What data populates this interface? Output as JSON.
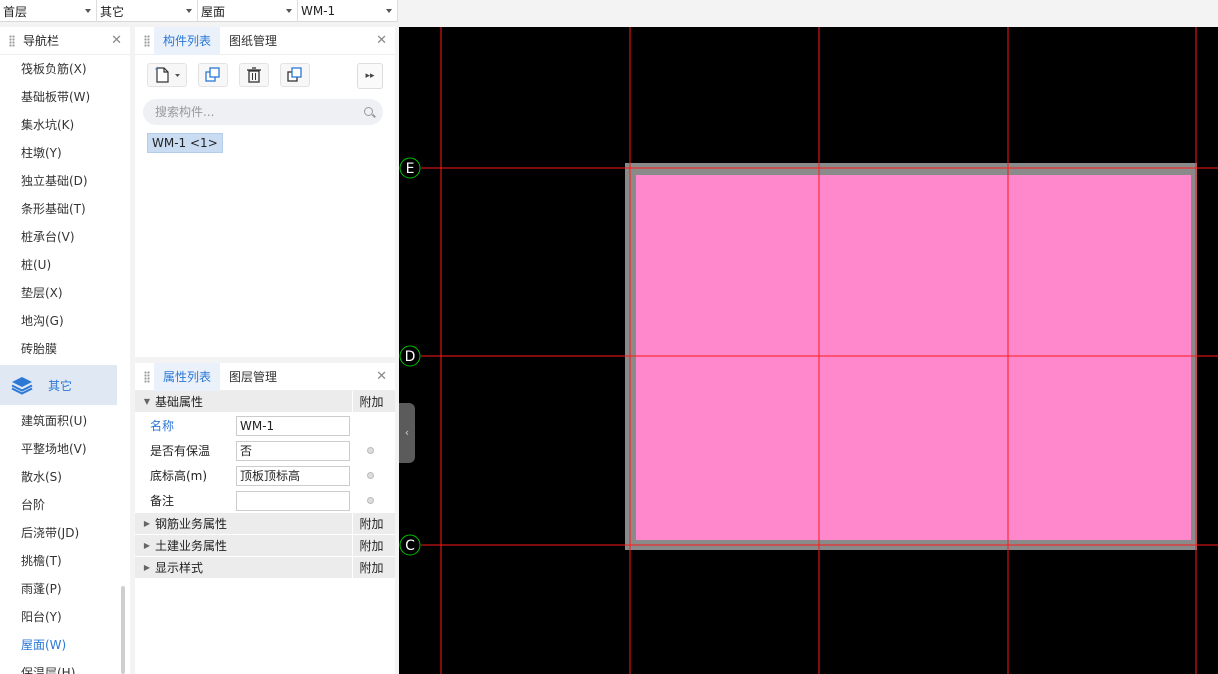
{
  "top_selectors": [
    {
      "value": "首层"
    },
    {
      "value": "其它"
    },
    {
      "value": "屋面"
    },
    {
      "value": "WM-1"
    }
  ],
  "nav": {
    "title": "导航栏",
    "items_before": [
      "筏板负筋(X)",
      "基础板带(W)",
      "集水坑(K)",
      "柱墩(Y)",
      "独立基础(D)",
      "条形基础(T)",
      "桩承台(V)",
      "桩(U)",
      "垫层(X)",
      "地沟(G)",
      "砖胎膜"
    ],
    "group_label": "其它",
    "items_after": [
      "建筑面积(U)",
      "平整场地(V)",
      "散水(S)",
      "台阶",
      "后浇带(JD)",
      "挑檐(T)",
      "雨蓬(P)",
      "阳台(Y)",
      "屋面(W)",
      "保温层(H)"
    ],
    "active_item": "屋面(W)"
  },
  "component_panel": {
    "tabs": [
      "构件列表",
      "图纸管理"
    ],
    "search_placeholder": "搜索构件...",
    "item": "WM-1 <1>"
  },
  "property_panel": {
    "tabs": [
      "属性列表",
      "图层管理"
    ],
    "section_basic": "基础属性",
    "add_label": "附加",
    "rows": [
      {
        "key": "名称",
        "value": "WM-1"
      },
      {
        "key": "是否有保温",
        "value": "否"
      },
      {
        "key": "底标高(m)",
        "value": "顶板顶标高"
      },
      {
        "key": "备注",
        "value": ""
      }
    ],
    "sections_collapsed": [
      "钢筋业务属性",
      "土建业务属性",
      "显示样式"
    ]
  },
  "canvas": {
    "axis_labels": [
      "E",
      "D",
      "C"
    ],
    "colors": {
      "background": "#000000",
      "axis": "#ff0000",
      "roof_fill": "#ff88cc",
      "roof_border": "#8a8a8a",
      "axis_bubble": "#00c000"
    }
  }
}
